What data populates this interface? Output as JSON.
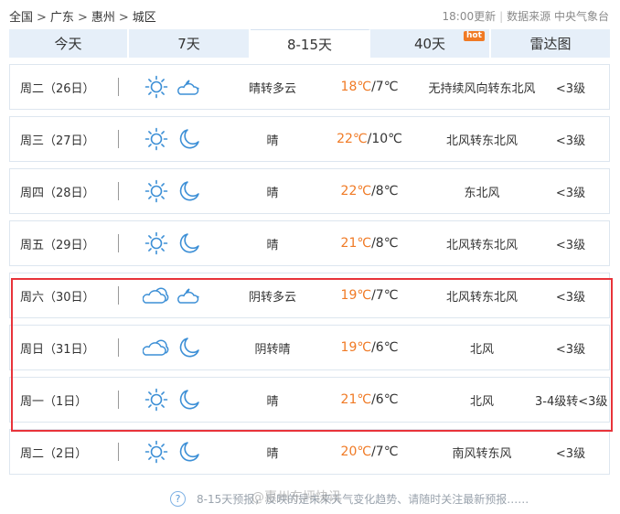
{
  "breadcrumb": {
    "items": [
      "全国",
      "广东",
      "惠州",
      "城区"
    ],
    "separator": ">"
  },
  "update": {
    "time": "18:00更新",
    "source": "数据来源 中央气象台"
  },
  "tabs": [
    {
      "label": "今天",
      "active": false
    },
    {
      "label": "7天",
      "active": false
    },
    {
      "label": "8-15天",
      "active": true
    },
    {
      "label": "40天",
      "active": false,
      "badge": "hot"
    },
    {
      "label": "雷达图",
      "active": false
    }
  ],
  "rows": [
    {
      "date": "周二（26日）",
      "icon_day": "sun-icon",
      "icon_night": "cloudy-night-icon",
      "desc": "晴转多云",
      "high": "18℃",
      "low": "/7℃",
      "wind": "无持续风向转东北风",
      "level": "<3级"
    },
    {
      "date": "周三（27日）",
      "icon_day": "sun-icon",
      "icon_night": "moon-icon",
      "desc": "晴",
      "high": "22℃",
      "low": "/10℃",
      "wind": "北风转东北风",
      "level": "<3级"
    },
    {
      "date": "周四（28日）",
      "icon_day": "sun-icon",
      "icon_night": "moon-icon",
      "desc": "晴",
      "high": "22℃",
      "low": "/8℃",
      "wind": "东北风",
      "level": "<3级"
    },
    {
      "date": "周五（29日）",
      "icon_day": "sun-icon",
      "icon_night": "moon-icon",
      "desc": "晴",
      "high": "21℃",
      "low": "/8℃",
      "wind": "北风转东北风",
      "level": "<3级"
    },
    {
      "date": "周六（30日）",
      "icon_day": "overcast-icon",
      "icon_night": "cloudy-night-icon",
      "desc": "阴转多云",
      "high": "19℃",
      "low": "/7℃",
      "wind": "北风转东北风",
      "level": "<3级"
    },
    {
      "date": "周日（31日）",
      "icon_day": "overcast-icon",
      "icon_night": "moon-icon",
      "desc": "阴转晴",
      "high": "19℃",
      "low": "/6℃",
      "wind": "北风",
      "level": "<3级"
    },
    {
      "date": "周一（1日）",
      "icon_day": "sun-icon",
      "icon_night": "moon-icon",
      "desc": "晴",
      "high": "21℃",
      "low": "/6℃",
      "wind": "北风",
      "level": "3-4级转<3级"
    },
    {
      "date": "周二（2日）",
      "icon_day": "sun-icon",
      "icon_night": "moon-icon",
      "desc": "晴",
      "high": "20℃",
      "low": "/7℃",
      "wind": "南风转东风",
      "level": "<3级"
    }
  ],
  "footer": {
    "help": "?",
    "text": "8-15天预报，反映的是未来天气变化趋势、请随时关注最新预报……"
  },
  "watermark": "@惠州东坪快讯",
  "colors": {
    "accent": "#f07a25",
    "tab_bg": "#e6eff9",
    "icon": "#3c8fd6",
    "highlight_border": "#e8333a"
  }
}
